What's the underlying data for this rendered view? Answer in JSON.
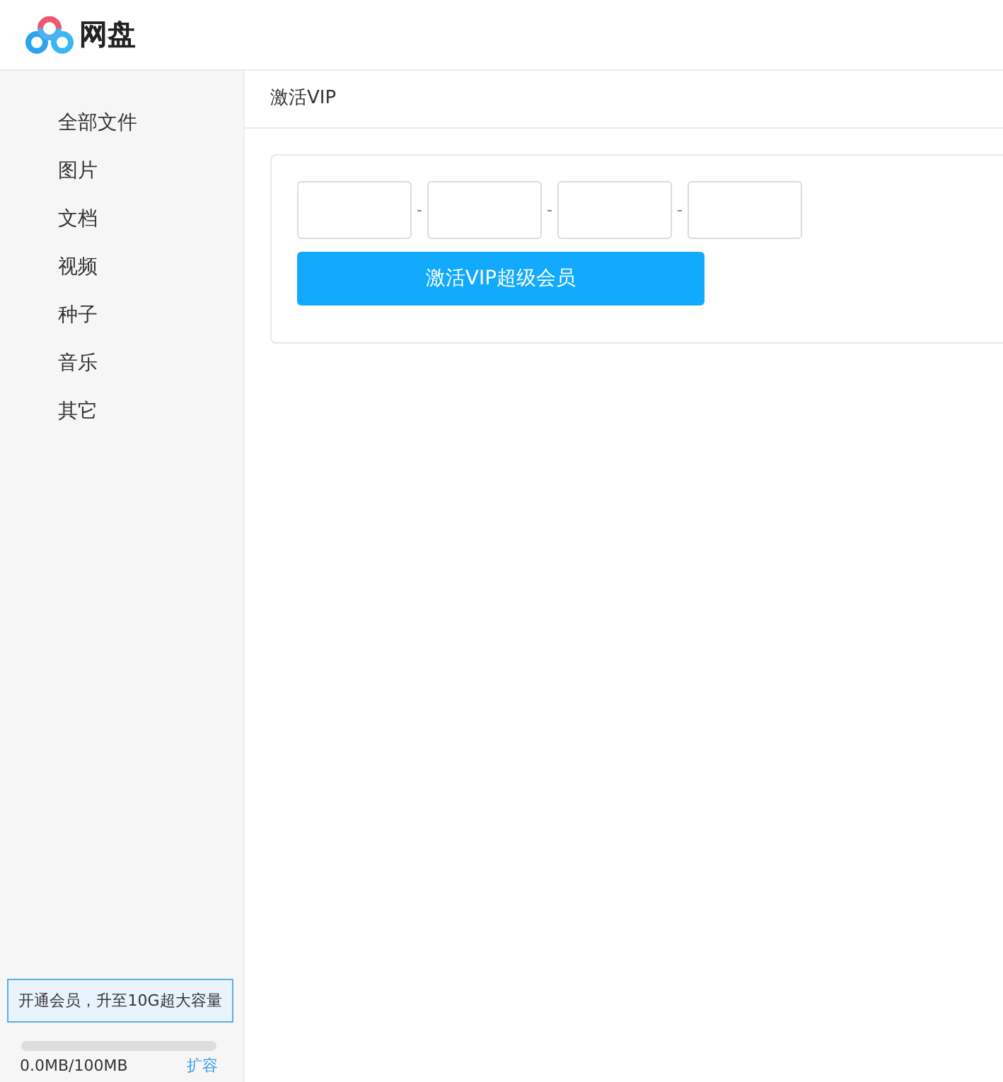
{
  "header": {
    "logo_text": "网盘"
  },
  "sidebar": {
    "items": [
      {
        "label": "全部文件"
      },
      {
        "label": "图片"
      },
      {
        "label": "文档"
      },
      {
        "label": "视频"
      },
      {
        "label": "种子"
      },
      {
        "label": "音乐"
      },
      {
        "label": "其它"
      }
    ],
    "promo": "开通会员，升至10G超大容量",
    "storage": {
      "level": 0,
      "reading": "0.0MB/100MB",
      "link": "扩容"
    }
  },
  "main": {
    "title": "激活VIP",
    "code_inputs": [
      {
        "kind": "field"
      },
      {
        "kind": "separator",
        "text": "-"
      },
      {
        "kind": "field"
      },
      {
        "kind": "separator",
        "text": "-"
      },
      {
        "kind": "field"
      },
      {
        "kind": "separator",
        "text": "-"
      },
      {
        "kind": "field"
      }
    ],
    "button": "激活VIP超级会员"
  }
}
